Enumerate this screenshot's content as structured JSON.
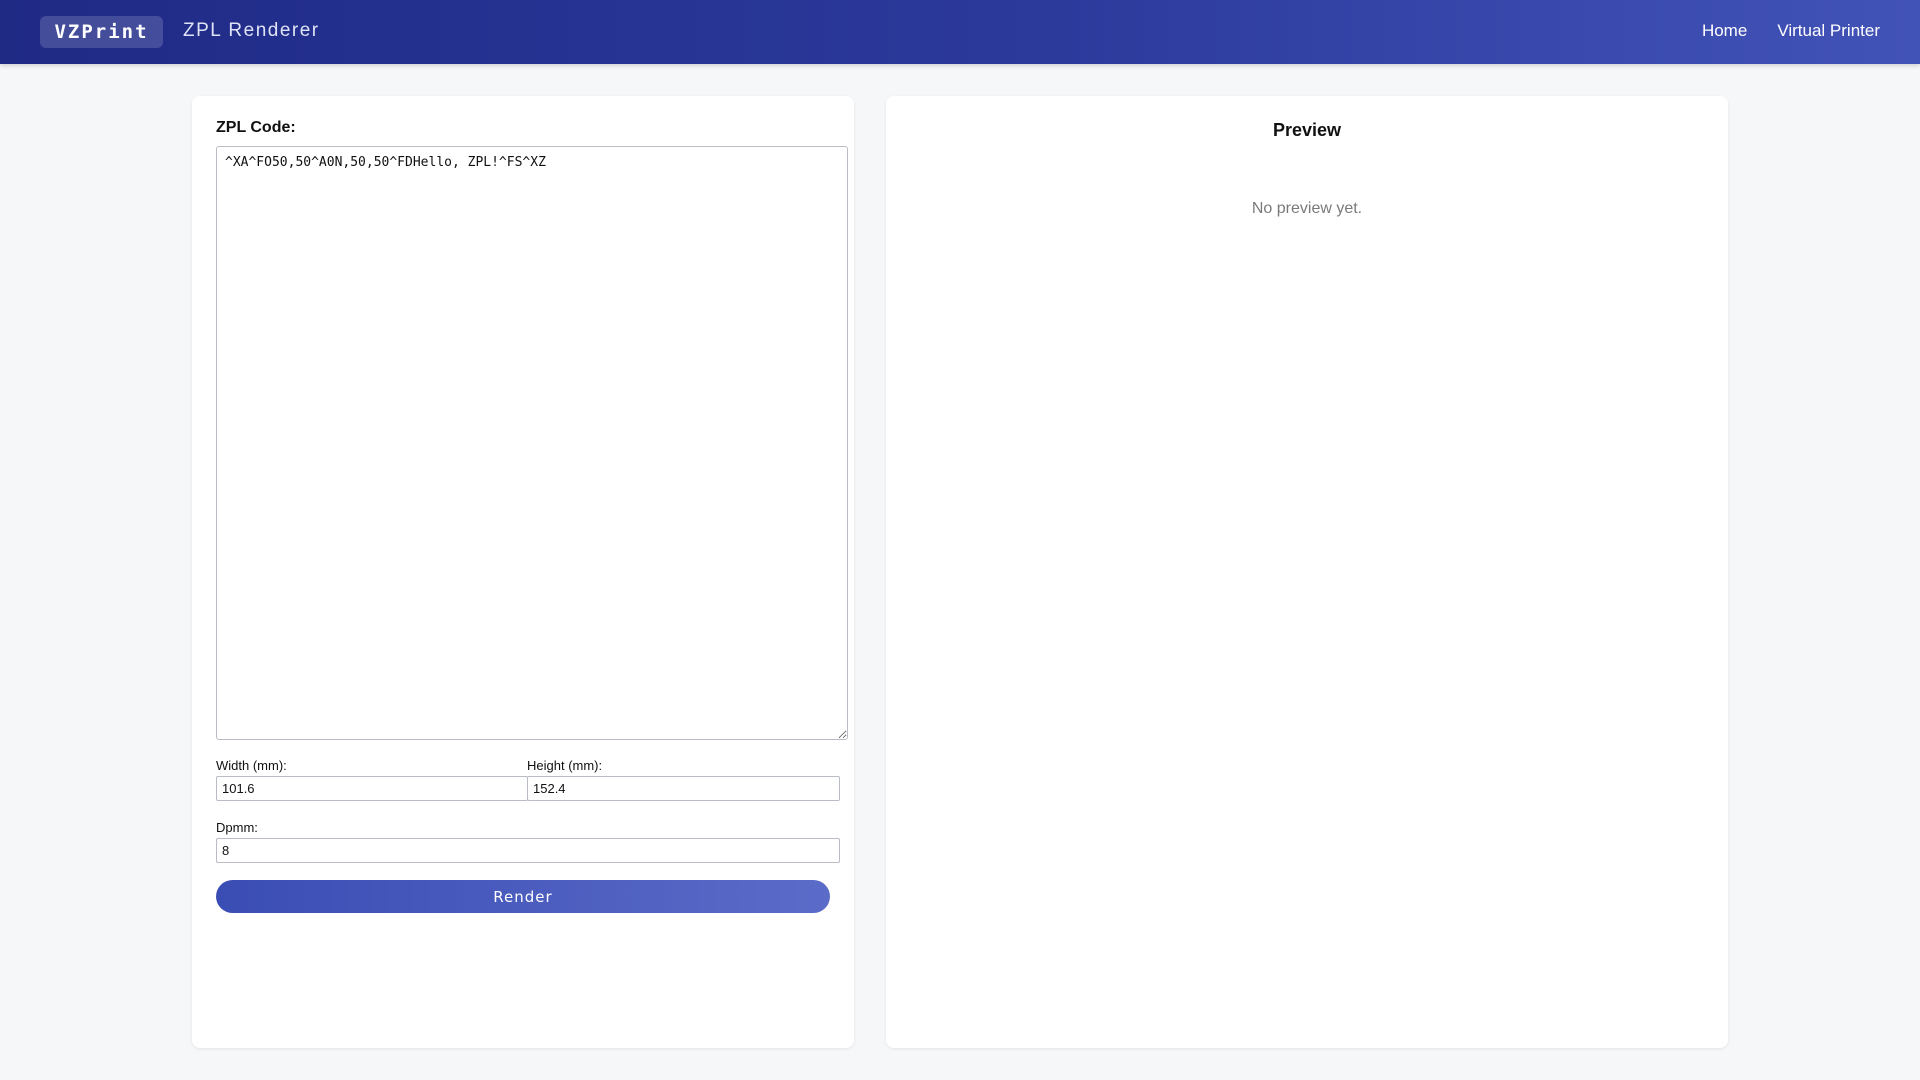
{
  "header": {
    "brand": "VZPrint",
    "title": "ZPL Renderer",
    "nav": [
      {
        "label": "Home"
      },
      {
        "label": "Virtual Printer"
      }
    ]
  },
  "editor": {
    "label": "ZPL Code:",
    "code": "^XA^FO50,50^A0N,50,50^FDHello, ZPL!^FS^XZ",
    "width_label": "Width (mm):",
    "width_value": "101.6",
    "height_label": "Height (mm):",
    "height_value": "152.4",
    "dpmm_label": "Dpmm:",
    "dpmm_value": "8",
    "render_label": "Render"
  },
  "preview": {
    "title": "Preview",
    "empty_text": "No preview yet."
  },
  "colors": {
    "header_start": "#1f2a85",
    "header_end": "#4253b8",
    "button_start": "#3a4db4",
    "button_end": "#5b6bc8",
    "background": "#f6f7f9"
  }
}
